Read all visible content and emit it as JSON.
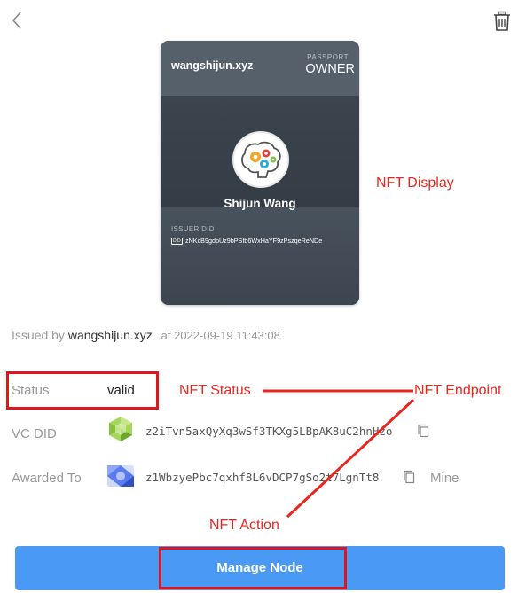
{
  "card": {
    "domain": "wangshijun.xyz",
    "passport_label": "PASSPORT",
    "role": "OWNER",
    "holder_name": "Shijun Wang",
    "issuer_label": "ISSUER DID",
    "did_badge": "DID",
    "issuer_did": "zNKcB9gdpUz9bPSfb6WxHaYF9zPszqeReNDe"
  },
  "issued": {
    "prefix": "Issued by",
    "issuer": "wangshijun.xyz",
    "timestamp": "at 2022-09-19 11:43:08"
  },
  "details": {
    "status_label": "Status",
    "status_value": "valid",
    "vc_did_label": "VC DID",
    "vc_did_value": "z2iTvn5axQyXq3wSf3TKXg5LBpAK8uC2hnHzo",
    "awarded_label": "Awarded To",
    "awarded_value": "z1WbzyePbc7qxhf8L6vDCP7gSo2t7LgnTt8",
    "mine_label": "Mine"
  },
  "actions": {
    "manage_label": "Manage Node"
  },
  "annotations": {
    "display": "NFT Display",
    "status": "NFT Status",
    "endpoint": "NFT Endpoint",
    "action": "NFT Action"
  },
  "icons": {
    "back": "chevron-left-icon",
    "delete": "trash-icon",
    "copy": "copy-icon"
  },
  "colors": {
    "accent": "#4a9af5",
    "annotation": "#e8261f",
    "card_bg": "#3e4650"
  }
}
